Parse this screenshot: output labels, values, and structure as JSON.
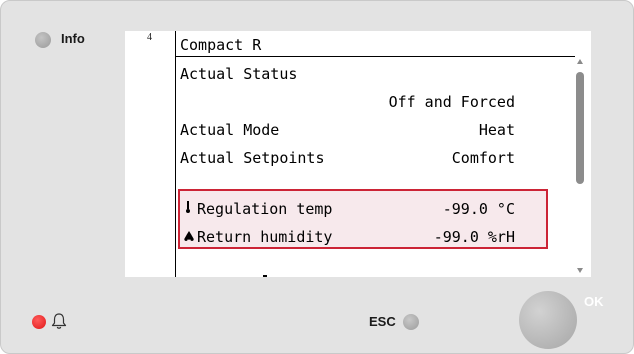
{
  "panel": {
    "info_label": "Info",
    "esc_label": "ESC",
    "ok_label": "OK"
  },
  "screen": {
    "line_number": "4",
    "title": "Compact R",
    "rows": [
      {
        "label": "Actual Status",
        "value": ""
      },
      {
        "label": "",
        "value": "Off and Forced"
      },
      {
        "label": "Actual Mode",
        "value": "Heat"
      },
      {
        "label": "Actual Setpoints",
        "value": "Comfort"
      }
    ],
    "highlighted": [
      {
        "icon": "thermometer-icon",
        "glyph": "🌡",
        "label": "Regulation temp",
        "value": "-99.0 °C"
      },
      {
        "icon": "humidity-drops-icon",
        "glyph": "💧",
        "label": "Return humidity",
        "value": "-99.0 %rH"
      }
    ]
  },
  "colors": {
    "highlight_border": "#cc2436",
    "alarm_led": "#e01818",
    "panel_bg": "#e3e3e3"
  }
}
